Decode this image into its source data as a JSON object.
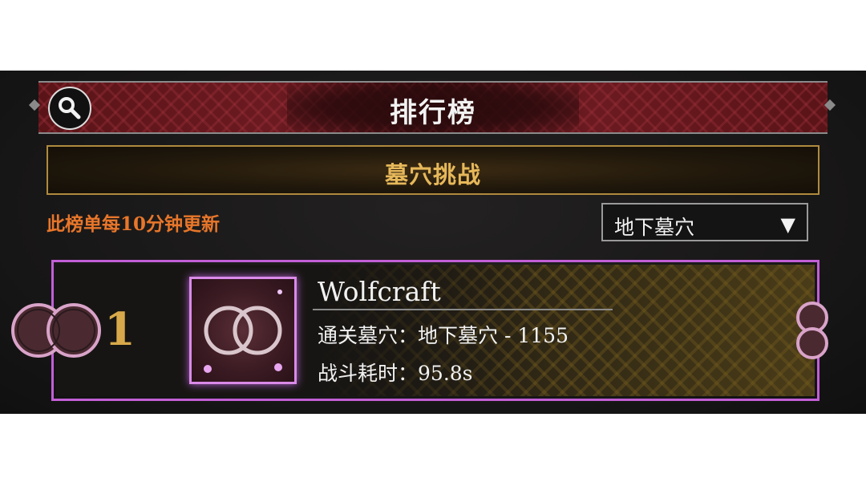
{
  "header": {
    "title": "排行榜"
  },
  "banner": {
    "label": "墓穴挑战"
  },
  "update_note": "此榜单每10分钟更新",
  "filter": {
    "selected": "地下墓穴",
    "arrow": "▼"
  },
  "entry": {
    "rank": "1",
    "player_name": "Wolfcraft",
    "cleared_label": "通关墓穴：",
    "cleared_value": "地下墓穴 - 1155",
    "time_label": "战斗耗时：",
    "time_value": "95.8s"
  },
  "icons": [
    "search-icon",
    "dropdown-arrow-icon",
    "rank-ring-icon",
    "avatar-rings-icon"
  ],
  "colors": {
    "accent_orange": "#e8762a",
    "gold": "#e6b85a",
    "frame_purple": "#c25fd6",
    "header_red": "#6b1a20"
  }
}
